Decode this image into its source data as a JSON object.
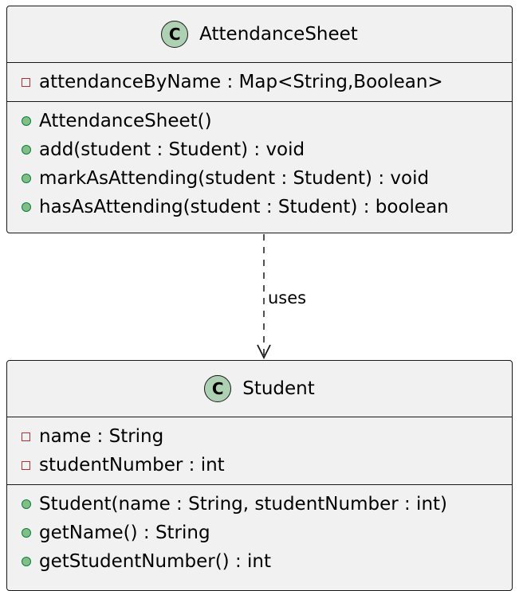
{
  "classes": [
    {
      "name": "AttendanceSheet",
      "icon": "C",
      "attributes": [
        {
          "visibility": "private",
          "text": "attendanceByName : Map<String,Boolean>"
        }
      ],
      "methods": [
        {
          "visibility": "public",
          "text": "AttendanceSheet()"
        },
        {
          "visibility": "public",
          "text": "add(student : Student) : void"
        },
        {
          "visibility": "public",
          "text": "markAsAttending(student : Student) : void"
        },
        {
          "visibility": "public",
          "text": "hasAsAttending(student : Student) : boolean"
        }
      ]
    },
    {
      "name": "Student",
      "icon": "C",
      "attributes": [
        {
          "visibility": "private",
          "text": "name : String"
        },
        {
          "visibility": "private",
          "text": "studentNumber : int"
        }
      ],
      "methods": [
        {
          "visibility": "public",
          "text": "Student(name : String, studentNumber : int)"
        },
        {
          "visibility": "public",
          "text": "getName() : String"
        },
        {
          "visibility": "public",
          "text": "getStudentNumber() : int"
        }
      ]
    }
  ],
  "relation": {
    "label": "uses",
    "style": "dashed",
    "from": "AttendanceSheet",
    "to": "Student"
  },
  "colors": {
    "box_fill": "#f1f1f1",
    "icon_fill": "#add1b2",
    "private": "#c82930",
    "public": "#84be84",
    "line": "#181818"
  }
}
